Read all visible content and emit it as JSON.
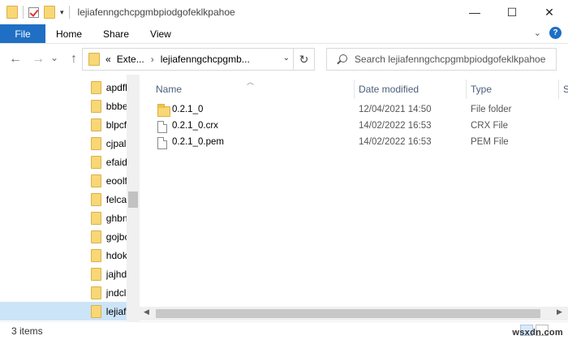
{
  "window": {
    "title": "lejiafenngchcpgmbpiodgofeklkpahoe",
    "controls": {
      "minimize": "—",
      "maximize": "☐",
      "close": "✕"
    }
  },
  "ribbon": {
    "file": "File",
    "tabs": [
      "Home",
      "Share",
      "View"
    ]
  },
  "navigation": {
    "back": "←",
    "forward": "→",
    "recent": "⌄",
    "up": "↑",
    "address_prefix": "«",
    "address_segments": [
      "Exte...",
      "lejiafenngchcpgmb..."
    ],
    "address_separator": "›",
    "refresh": "↻",
    "search_placeholder": "Search lejiafenngchcpgmbpiodgofeklkpahoe"
  },
  "tree": {
    "items": [
      {
        "label": "apdfl",
        "selected": false
      },
      {
        "label": "bbbe",
        "selected": false
      },
      {
        "label": "blpcf",
        "selected": false
      },
      {
        "label": "cjpall",
        "selected": false
      },
      {
        "label": "efaid",
        "selected": false
      },
      {
        "label": "eoolf",
        "selected": false
      },
      {
        "label": "felcaa",
        "selected": false
      },
      {
        "label": "ghbn",
        "selected": false
      },
      {
        "label": "gojbc",
        "selected": false
      },
      {
        "label": "hdok",
        "selected": false
      },
      {
        "label": "jajhd",
        "selected": false
      },
      {
        "label": "jndcl",
        "selected": false
      },
      {
        "label": "lejiafe",
        "selected": true
      }
    ]
  },
  "file_list": {
    "columns": {
      "name": "Name",
      "date": "Date modified",
      "type": "Type",
      "size": "S"
    },
    "rows": [
      {
        "icon": "folder-icon",
        "name": "0.2.1_0",
        "date": "12/04/2021 14:50",
        "type": "File folder"
      },
      {
        "icon": "file-icon",
        "name": "0.2.1_0.crx",
        "date": "14/02/2022 16:53",
        "type": "CRX File"
      },
      {
        "icon": "file-icon",
        "name": "0.2.1_0.pem",
        "date": "14/02/2022 16:53",
        "type": "PEM File"
      }
    ]
  },
  "status": {
    "item_count": "3 items",
    "watermark": "wsxdn.com"
  },
  "colors": {
    "file_tab": "#1f6fc4",
    "selection": "#cce4f7",
    "folder": "#f8d775",
    "header_text": "#4b5d7a"
  }
}
